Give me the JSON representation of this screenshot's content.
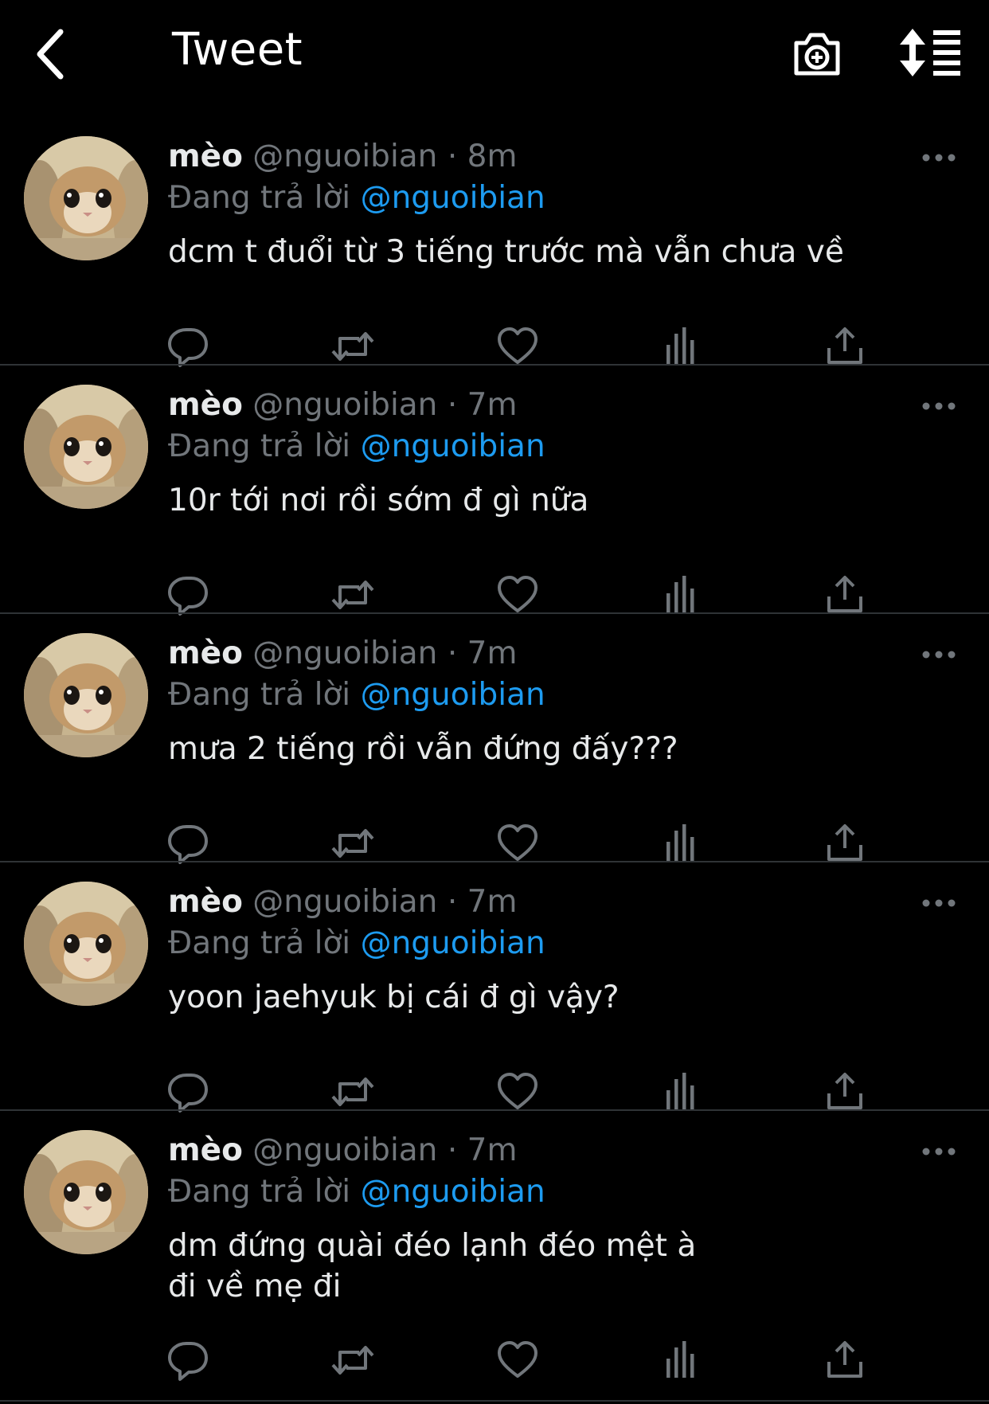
{
  "header": {
    "title": "Tweet",
    "back_icon": "chevron-left-icon",
    "camera_icon": "camera-plus-icon",
    "sort_icon": "sort-list-icon"
  },
  "colors": {
    "background": "#000000",
    "text": "#e7e9ea",
    "muted": "#71767b",
    "accent": "#1d9bf0",
    "divider": "#2f3336"
  },
  "tweets": [
    {
      "name": "mèo",
      "handle": "@nguoibian",
      "sep": "·",
      "time": "8m",
      "reply_prefix": "Đang trả lời",
      "reply_to": "@nguoibian",
      "text": "dcm t đuổi từ 3 tiếng trước mà vẫn chưa về"
    },
    {
      "name": "mèo",
      "handle": "@nguoibian",
      "sep": "·",
      "time": "7m",
      "reply_prefix": "Đang trả lời",
      "reply_to": "@nguoibian",
      "text": "10r tới nơi rồi sớm đ gì nữa"
    },
    {
      "name": "mèo",
      "handle": "@nguoibian",
      "sep": "·",
      "time": "7m",
      "reply_prefix": "Đang trả lời",
      "reply_to": "@nguoibian",
      "text": "mưa 2 tiếng rồi vẫn đứng đấy???"
    },
    {
      "name": "mèo",
      "handle": "@nguoibian",
      "sep": "·",
      "time": "7m",
      "reply_prefix": "Đang trả lời",
      "reply_to": "@nguoibian",
      "text": "yoon jaehyuk bị cái đ gì vậy?"
    },
    {
      "name": "mèo",
      "handle": "@nguoibian",
      "sep": "·",
      "time": "7m",
      "reply_prefix": "Đang trả lời",
      "reply_to": "@nguoibian",
      "text": "dm đứng quài đéo lạnh đéo mệt à\nđi về mẹ đi"
    }
  ],
  "actions": [
    "reply-icon",
    "retweet-icon",
    "like-icon",
    "analytics-icon",
    "share-icon"
  ]
}
